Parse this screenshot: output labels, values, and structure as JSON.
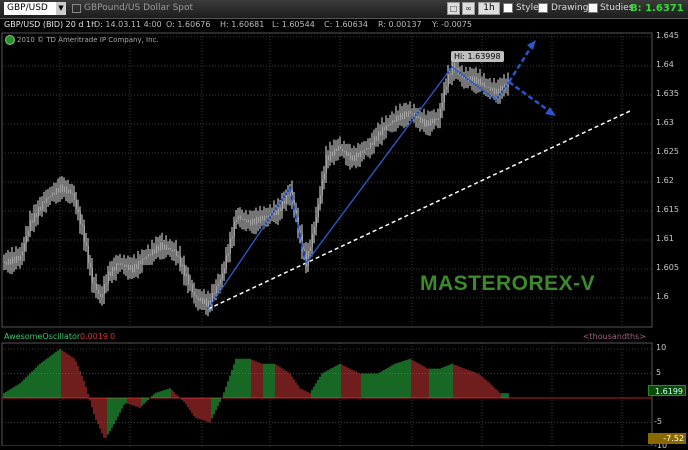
{
  "toolbar": {
    "symbol": "GBP/USD",
    "description": "GBPound/US Dollar Spot",
    "aggregation": "1h",
    "style_label": "Style",
    "drawings_label": "Drawings",
    "studies_label": "Studies",
    "bid": "B: 1.6371"
  },
  "quote_bar": {
    "symbol": "GBP/USD (BID) 20 d 1h",
    "date": "D: 14.03.11 4:00",
    "open": "O: 1.60676",
    "high": "H: 1.60681",
    "low": "L: 1.60544",
    "close": "C: 1.60634",
    "range": "R: 0.00137",
    "change": "Y: -0.0075"
  },
  "copyright": "2010 © TD Ameritrade IP Company, Inc.",
  "hi_label": "Hi: 1.63998",
  "watermark": "MASTEROREX-V",
  "price_axis": [
    "1.645",
    "1.64",
    "1.635",
    "1.63",
    "1.625",
    "1.62",
    "1.615",
    "1.61",
    "1.605",
    "1.6"
  ],
  "price_axis_values": [
    1.645,
    1.64,
    1.635,
    1.63,
    1.625,
    1.62,
    1.615,
    1.61,
    1.605,
    1.6
  ],
  "indicator": {
    "name": "AwesomeOscillator",
    "value": "0.0019",
    "zero": "0",
    "units": "<thousandths>",
    "axis": [
      "10",
      "5",
      "-5",
      "-10"
    ],
    "axis_values": [
      10,
      5,
      -5,
      -10
    ],
    "current_tag": "1.6199",
    "low_tag": "-7.52"
  },
  "colors": {
    "bull": "#2ecf4a",
    "bear": "#e03a3a",
    "candle": "#e8e8e8",
    "pattern": "#2b56c8",
    "watermark": "#3c8a2a",
    "bid": "#33dd33"
  }
}
